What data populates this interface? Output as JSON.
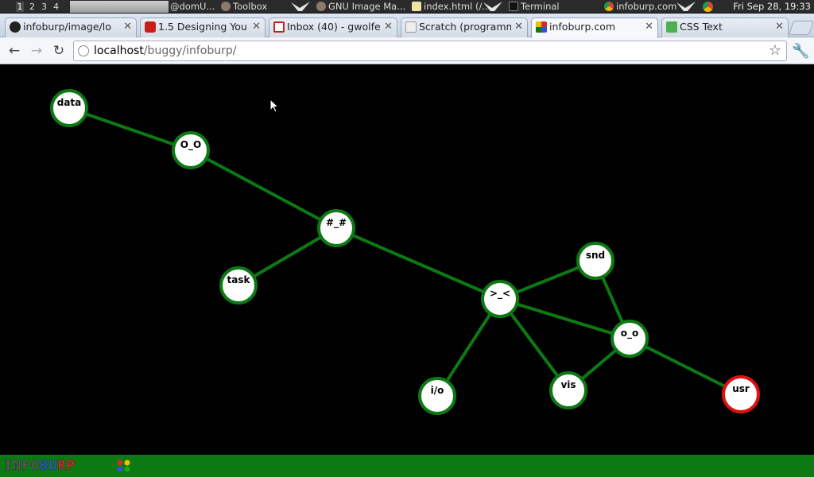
{
  "taskbar": {
    "workspaces": [
      "1",
      "2",
      "3",
      "4"
    ],
    "tasks": [
      {
        "label": "@domU...",
        "icon": "terminal-icon"
      },
      {
        "label": "Toolbox",
        "icon": "gimp-icon"
      },
      {
        "label": "GNU Image Ma...",
        "icon": "gimp-icon"
      },
      {
        "label": "index.html (/...",
        "icon": "text-editor-icon"
      },
      {
        "label": "Terminal",
        "icon": "terminal-icon"
      },
      {
        "label": "infoburp.com",
        "icon": "chrome-icon"
      }
    ],
    "clock": "Fri Sep 28, 19:33"
  },
  "browser": {
    "tabs": [
      {
        "label": "infoburp/image/lo",
        "icon": "github-icon",
        "color": "#222222"
      },
      {
        "label": "1.5 Designing You",
        "icon": "youtube-icon",
        "color": "#cc1b1b"
      },
      {
        "label": "Inbox (40) - gwolfe",
        "icon": "gmail-icon",
        "color": "#c5221f"
      },
      {
        "label": "Scratch (programm",
        "icon": "wikipedia-icon",
        "color": "#333333"
      },
      {
        "label": "infoburp.com",
        "icon": "infoburp-icon",
        "color": "#0c7a12"
      },
      {
        "label": "CSS Text",
        "icon": "w3schools-icon",
        "color": "#4caf50"
      }
    ],
    "active_tab": 4,
    "url_host": "localhost",
    "url_path": "/buggy/infoburp/"
  },
  "graph": {
    "edge_color": "#0c7a12",
    "node_border": "#0c7a12",
    "highlight_border": "#e01010",
    "nodes": [
      {
        "id": "data",
        "label": "data"
      },
      {
        "id": "oo1",
        "label": "O_O"
      },
      {
        "id": "hash",
        "label": "#_#"
      },
      {
        "id": "task",
        "label": "task"
      },
      {
        "id": "gtlt",
        "label": ">_<"
      },
      {
        "id": "snd",
        "label": "snd"
      },
      {
        "id": "oo2",
        "label": "o_o"
      },
      {
        "id": "io",
        "label": "i/o"
      },
      {
        "id": "vis",
        "label": "vis"
      },
      {
        "id": "usr",
        "label": "usr",
        "highlight": true
      }
    ],
    "edges": [
      [
        "data",
        "oo1"
      ],
      [
        "oo1",
        "hash"
      ],
      [
        "hash",
        "task"
      ],
      [
        "hash",
        "gtlt"
      ],
      [
        "gtlt",
        "snd"
      ],
      [
        "gtlt",
        "oo2"
      ],
      [
        "gtlt",
        "io"
      ],
      [
        "gtlt",
        "vis"
      ],
      [
        "snd",
        "oo2"
      ],
      [
        "oo2",
        "vis"
      ],
      [
        "oo2",
        "usr"
      ]
    ]
  },
  "footer": {
    "logo": "INFOBURP",
    "logo_colors": [
      "#5a5a5a",
      "#5a5a5a",
      "#5a5a5a",
      "#5a5a5a",
      "#2a56d4",
      "#2a56d4",
      "#d42a2a",
      "#d42a2a"
    ]
  }
}
